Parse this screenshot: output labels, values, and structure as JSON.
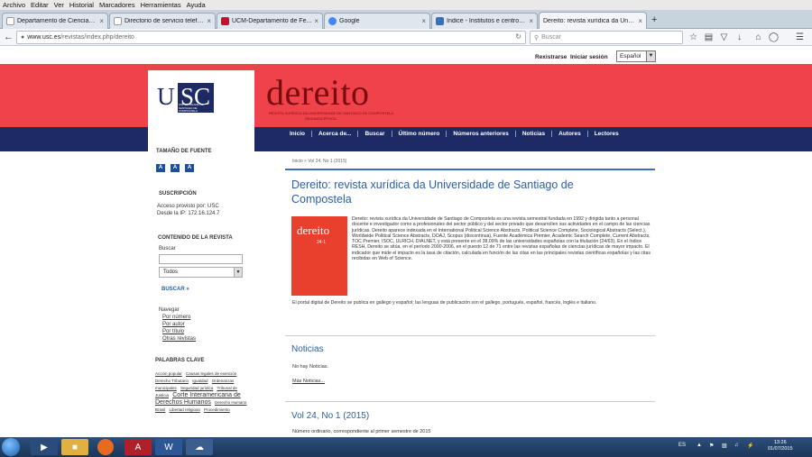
{
  "browser": {
    "menu": [
      "Archivo",
      "Editar",
      "Ver",
      "Historial",
      "Marcadores",
      "Herramientas",
      "Ayuda"
    ],
    "tabs": [
      {
        "label": "Departamento de Ciencias ...",
        "active": false
      },
      {
        "label": "Directorio de servicio telefónico...",
        "active": false
      },
      {
        "label": "UCM-Departamento de Fe...",
        "active": false
      },
      {
        "label": "Google",
        "active": false
      },
      {
        "label": "Índice - Institutos e centros...",
        "active": false
      },
      {
        "label": "Dereito: revista xurídica da Univ...",
        "active": true
      }
    ],
    "url": {
      "host": "www.usc.es",
      "path": "/revistas/index.php/dereito"
    },
    "search_placeholder": "Buscar"
  },
  "page": {
    "user": {
      "register": "Rexistrarse",
      "login": "Iniciar sesión",
      "language": "Español"
    },
    "masthead": {
      "usc_letters": "USC",
      "usc_sub": "UNIVERSIDADE DE SANTIAGO DE COMPOSTELA",
      "title": "dereito",
      "subtitle": "REVISTA XURÍDICA DA UNIVERSIDADE DE SANTIAGO DE COMPOSTELA",
      "subtitle2": "SEGUNDA ÉPOCA"
    },
    "nav": [
      "Inicio",
      "Acerca de...",
      "Buscar",
      "Último número",
      "Números anteriores",
      "Noticias",
      "Autores",
      "Lectores"
    ],
    "sidebar": {
      "font_size_title": "TAMAÑO DE FUENTE",
      "font_buttons": [
        "A",
        "A",
        "A"
      ],
      "subscription_title": "SUSCRIPCIÓN",
      "subscription_text1": "Acceso provisto por: USC",
      "subscription_text2": "Desde la IP: 172.16.124.7",
      "content_title": "CONTENIDO DE LA REVISTA",
      "search_label": "Buscar",
      "search_scope": "Todos",
      "search_button": "BUSCAR",
      "browse_label": "Navegar",
      "browse_links": [
        "Por número",
        "Por autor",
        "Por título",
        "Otras revistas"
      ],
      "keywords_title": "PALABRAS CLAVE",
      "keywords": [
        {
          "text": "Acción popular",
          "big": false
        },
        {
          "text": "Causas legales de exención",
          "big": false
        },
        {
          "text": "Derecho Tributario",
          "big": false
        },
        {
          "text": "Igualdad",
          "big": false
        },
        {
          "text": "Ordenanzas municipales",
          "big": false
        },
        {
          "text": "Seguridad jurídica",
          "big": false
        },
        {
          "text": "Tribunal de Justicia",
          "big": false
        },
        {
          "text": "Corte Interamericana de Derechos Humanos",
          "big": true
        },
        {
          "text": "Derecho Humano",
          "big": false
        },
        {
          "text": "Brasil",
          "big": false
        },
        {
          "text": "Libertad religiosa",
          "big": false
        },
        {
          "text": "Procedimiento",
          "big": false
        }
      ]
    },
    "main": {
      "breadcrumb": "Inicio > Vol 24, No 1 (2015)",
      "journal_title": "Dereito: revista xurídica da Universidade de Santiago de Compostela",
      "cover_title": "dereito",
      "cover_number": "24·1",
      "about": "Dereito: revista xurídica da Universidade de Santiago de Compostela es una revista semestral fundada en 1992 y dirigida tanto a personal docente e investigador como a profesionales del sector público y del sector privado que desarrollen sus actividades en el campo de las ciencias jurídicas. Dereito aparece indexada en el International Political Science Abstracts, Political Science Complete, Sociological Abstracts (Select.), Worldwide Political Science Abstracts, DOAJ, Scopus (discontinua), Fuente Académica Premier, Academic Search Complete, Current Abstracts, TOC Premier, ISOC, ULRICH, DIALNET, y está presente en el 38,09% de las universidades españolas con la titulación (24/63). En el índice RESH, Dereito se sitúa, en el período 2000-2006, en el puesto 12 de 71 entre las revistas españolas de ciencias jurídicas de mayor impacto. El indicador que mide el impacto es la tasa de citación, calculada en función de las citas en las principales revistas científicas españolas y las citas recibidas en Web of Science.",
      "about2": "El portal digital de Dereito se publica en gallego y español; las lenguas de publicación son el gallego, portugués, español, francés, inglés e italiano.",
      "news_title": "Noticias",
      "news_text": "No hay Noticias.",
      "news_more": "Más Noticias...",
      "issue_title": "Vol 24, No 1 (2015)",
      "issue_text": "Número ordinario, correspondiente al primer semestre de 2015"
    }
  },
  "taskbar": {
    "lang": "ES",
    "time": "13:26",
    "date": "01/07/2015"
  },
  "colors": {
    "red_band": "#f0424a",
    "navy": "#1d2a64",
    "link_blue": "#2a5fa5",
    "cover_red": "#e8402c"
  }
}
